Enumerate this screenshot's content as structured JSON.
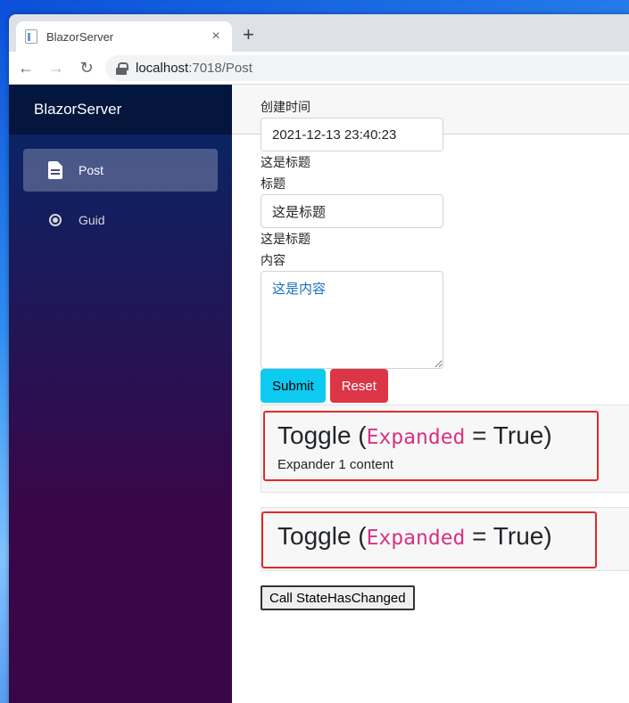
{
  "browser": {
    "tab_title": "BlazorServer",
    "tab_close": "×",
    "new_tab": "+",
    "back": "←",
    "forward": "→",
    "reload": "↻",
    "url_host": "localhost",
    "url_path": ":7018/Post"
  },
  "sidebar": {
    "brand": "BlazorServer",
    "items": [
      {
        "label": "Post",
        "icon": "document-icon",
        "active": true
      },
      {
        "label": "Guid",
        "icon": "radio-icon",
        "active": false
      }
    ]
  },
  "form": {
    "created_label": "创建时间",
    "created_value": "2021-12-13 23:40:23",
    "echo_title_1": "这是标题",
    "title_label": "标题",
    "title_value": "这是标题",
    "echo_title_2": "这是标题",
    "content_label": "内容",
    "content_value": "这是内容",
    "submit_label": "Submit",
    "reset_label": "Reset"
  },
  "expanders": [
    {
      "prefix": "Toggle (",
      "code": "Expanded",
      "suffix": " = True)",
      "content": "Expander 1 content"
    },
    {
      "prefix": "Toggle (",
      "code": "Expanded",
      "suffix": " = True)"
    }
  ],
  "state_button_label": "Call StateHasChanged",
  "colors": {
    "submit": "#0dcaf0",
    "reset": "#dc3545",
    "highlight_border": "#e02b27",
    "code": "#d63384"
  }
}
